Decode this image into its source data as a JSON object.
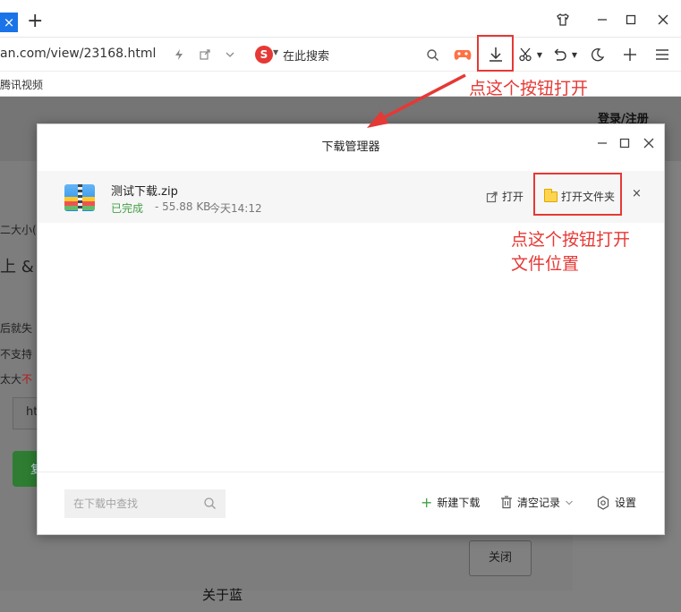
{
  "browser": {
    "tab_close_glyph": "×",
    "new_tab_glyph": "+",
    "url": "an.com/view/23168.html",
    "search_placeholder": "在此搜索",
    "search_logo": "S",
    "bookmark": "腾讯视频"
  },
  "page": {
    "login": "登录/注册",
    "fragments": [
      "二大小(",
      "上 & 须",
      "后就失",
      "不支持",
      "太大",
      "不",
      "ht",
      "复"
    ],
    "close_button": "关闭",
    "footer": "关于蓝"
  },
  "download_manager": {
    "title": "下载管理器",
    "file": {
      "name": "测试下载.zip",
      "status": "已完成",
      "size": "- 55.88 KB",
      "time": "今天14:12"
    },
    "open_label": "打开",
    "open_folder_label": "打开文件夹",
    "remove_glyph": "×",
    "search_placeholder": "在下载中查找",
    "new_download_label": "新建下载",
    "clear_records_label": "清空记录",
    "settings_label": "设置"
  },
  "annotations": {
    "note_download_button": "点这个按钮打开",
    "note_folder_line1": "点这个按钮打开",
    "note_folder_line2": "文件位置"
  },
  "colors": {
    "accent_red": "#e53935",
    "success_green": "#43a047"
  }
}
